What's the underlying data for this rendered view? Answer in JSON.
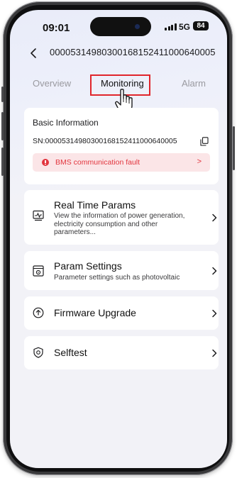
{
  "status_bar": {
    "time": "09:01",
    "network": "5G",
    "battery": "84"
  },
  "nav": {
    "device_id": "00005314980300168152411000640005"
  },
  "tabs": [
    {
      "label": "Overview",
      "active": false
    },
    {
      "label": "Monitoring",
      "active": true
    },
    {
      "label": "Alarm",
      "active": false
    }
  ],
  "basic_info": {
    "title": "Basic Information",
    "sn": "SN:00005314980300168152411000640005",
    "fault_text": "BMS communication fault"
  },
  "menu": [
    {
      "icon": "realtime-chart-icon",
      "title": "Real Time Params",
      "description": "View the information of power generation, electricity consumption and other parameters..."
    },
    {
      "icon": "param-settings-icon",
      "title": "Param Settings",
      "description": "Parameter settings such as photovoltaic"
    },
    {
      "icon": "firmware-upgrade-icon",
      "title": "Firmware Upgrade",
      "description": ""
    },
    {
      "icon": "selftest-shield-icon",
      "title": "Selftest",
      "description": ""
    }
  ],
  "colors": {
    "accent_highlight": "#e0252b",
    "fault_red": "#e2353e",
    "fault_bg": "#fbe5e7",
    "screen_bg": "#f2f2f7"
  }
}
